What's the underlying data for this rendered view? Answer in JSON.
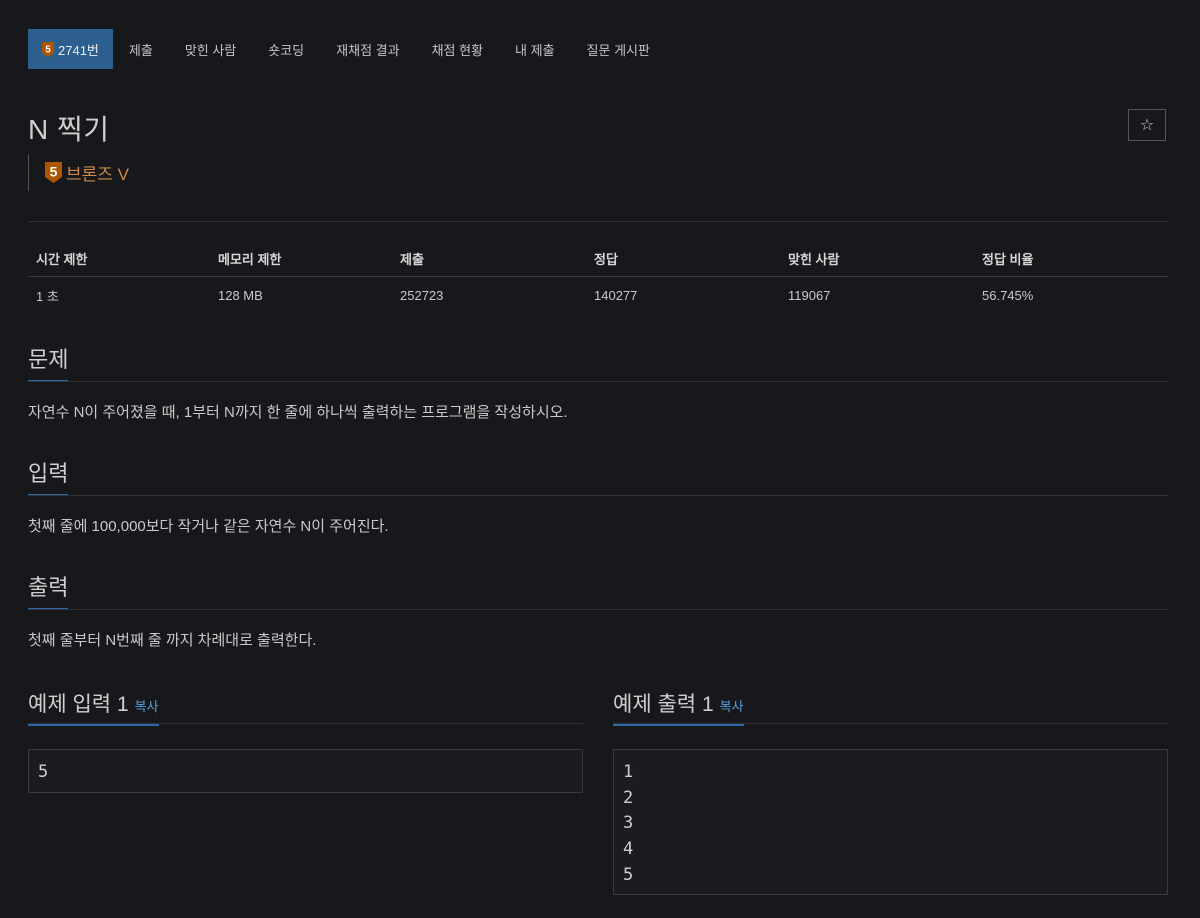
{
  "tabs": [
    {
      "label": "2741번",
      "tier": "5",
      "active": true
    },
    {
      "label": "제출"
    },
    {
      "label": "맞힌 사람"
    },
    {
      "label": "숏코딩"
    },
    {
      "label": "재채점 결과"
    },
    {
      "label": "채점 현황"
    },
    {
      "label": "내 제출"
    },
    {
      "label": "질문 게시판"
    }
  ],
  "problem": {
    "title": "N 찍기",
    "star": "☆",
    "tier_level": "5",
    "tier_name": "브론즈 V",
    "tier_color": "#d08a46"
  },
  "stats": {
    "headers": [
      "시간 제한",
      "메모리 제한",
      "제출",
      "정답",
      "맞힌 사람",
      "정답 비율"
    ],
    "values": [
      "1 초",
      "128 MB",
      "252723",
      "140277",
      "119067",
      "56.745%"
    ]
  },
  "sections": {
    "problem": {
      "title": "문제",
      "text": "자연수 N이 주어졌을 때, 1부터 N까지 한 줄에 하나씩 출력하는 프로그램을 작성하시오."
    },
    "input": {
      "title": "입력",
      "text": "첫째 줄에 100,000보다 작거나 같은 자연수 N이 주어진다."
    },
    "output": {
      "title": "출력",
      "text": "첫째 줄부터 N번째 줄 까지 차례대로 출력한다."
    }
  },
  "examples": {
    "input": {
      "title": "예제 입력 1",
      "copy": "복사",
      "lines": [
        "5"
      ]
    },
    "output": {
      "title": "예제 출력 1",
      "copy": "복사",
      "lines": [
        "1",
        "2",
        "3",
        "4",
        "5"
      ]
    }
  },
  "colors": {
    "accent": "#2c5e8e",
    "underline": "#2c6aa8",
    "link": "#5b9fdb",
    "bronze": "#d08a46"
  }
}
